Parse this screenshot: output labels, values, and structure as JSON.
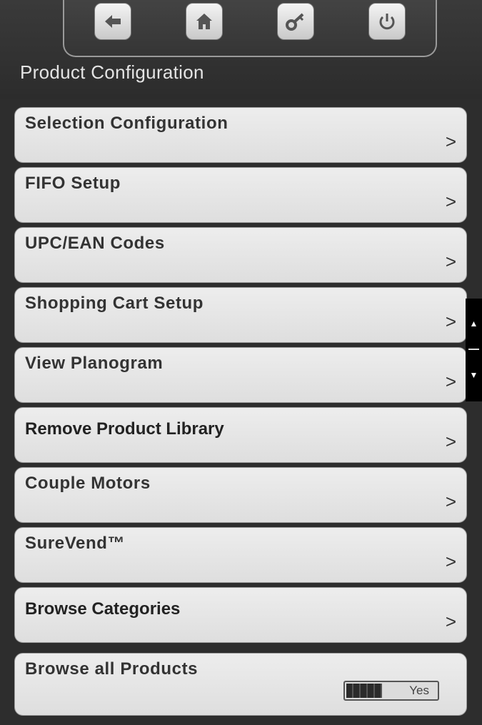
{
  "header": {
    "title": "Product Configuration",
    "nav": [
      {
        "name": "back-button",
        "icon": "back-arrow-icon"
      },
      {
        "name": "home-button",
        "icon": "home-icon"
      },
      {
        "name": "key-button",
        "icon": "key-icon"
      },
      {
        "name": "power-button",
        "icon": "power-icon"
      }
    ]
  },
  "menu": {
    "items": [
      {
        "label": "Selection Configuration",
        "chevron": ">"
      },
      {
        "label": "FIFO Setup",
        "chevron": ">"
      },
      {
        "label": "UPC/EAN Codes",
        "chevron": ">"
      },
      {
        "label": "Shopping Cart Setup",
        "chevron": ">"
      },
      {
        "label": "View Planogram",
        "chevron": ">"
      },
      {
        "label": "Remove Product Library",
        "chevron": ">"
      },
      {
        "label": "Couple Motors",
        "chevron": ">"
      },
      {
        "label": "SureVend™",
        "chevron": ">"
      },
      {
        "label": "Browse Categories",
        "chevron": ">"
      }
    ],
    "toggle_item": {
      "label": "Browse all Products",
      "value": "Yes"
    }
  },
  "colors": {
    "background": "#2d2d2d",
    "row": "#e6e6e6",
    "text": "#333333"
  }
}
